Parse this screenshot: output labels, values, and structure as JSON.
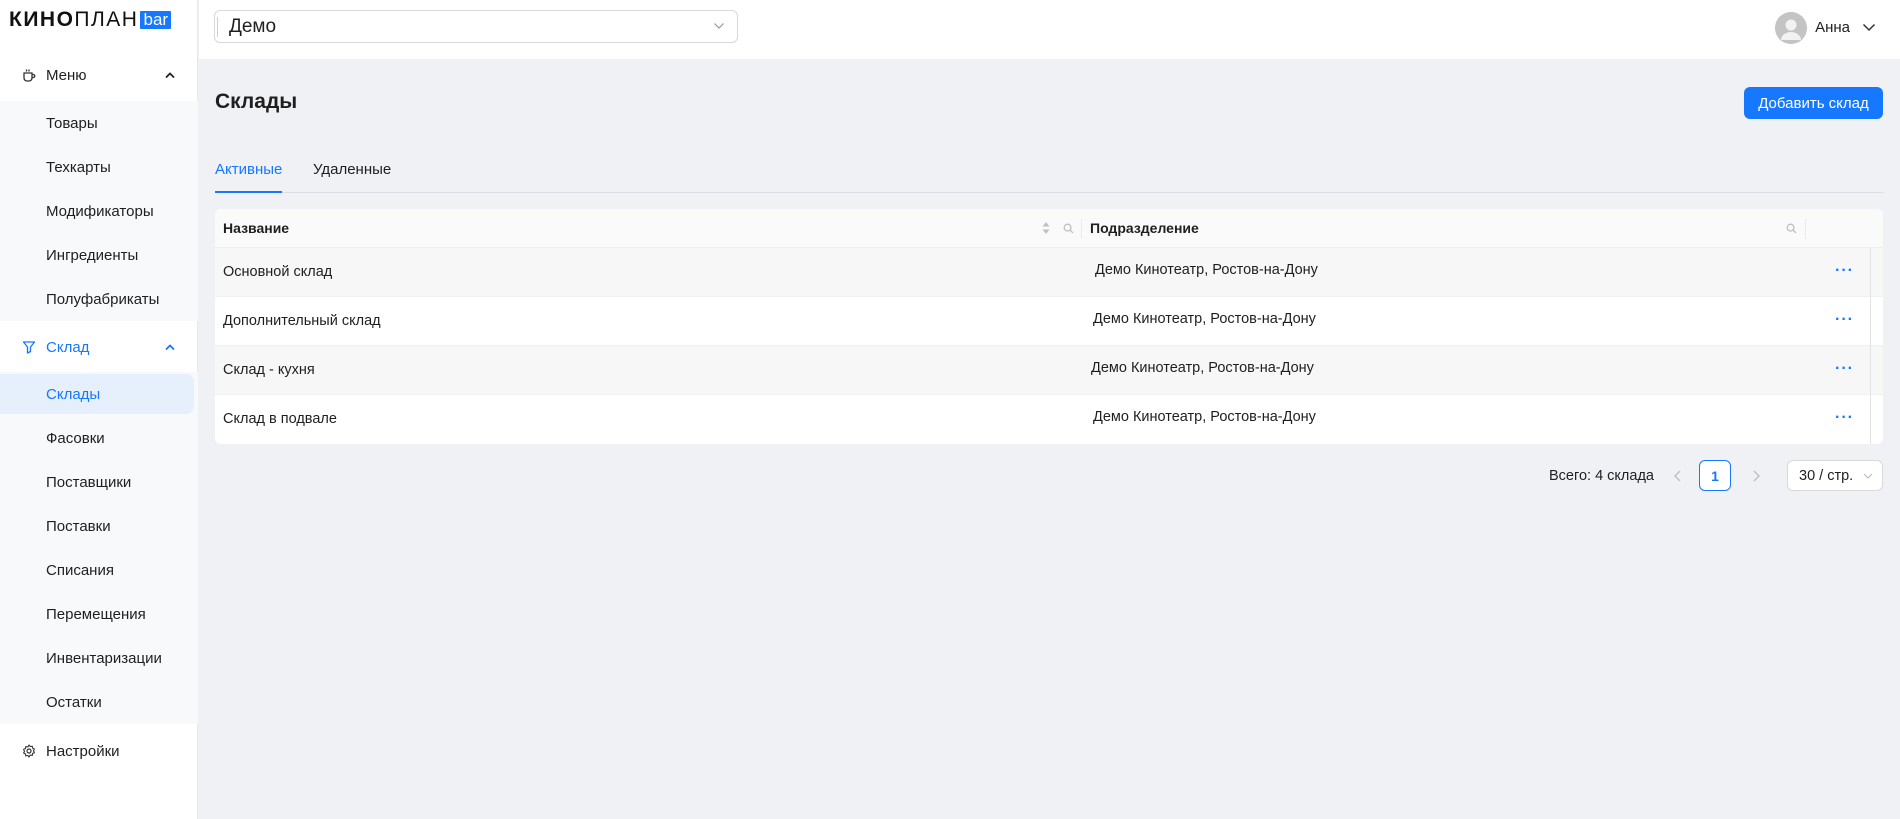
{
  "brand": {
    "part1": "КИНО",
    "part2": "ПЛАН",
    "part3": "bar"
  },
  "sidebar": {
    "menu": {
      "label": "Меню",
      "items": [
        "Товары",
        "Техкарты",
        "Модификаторы",
        "Ингредиенты",
        "Полуфабрикаты"
      ]
    },
    "warehouse": {
      "label": "Склад",
      "items": [
        "Склады",
        "Фасовки",
        "Поставщики",
        "Поставки",
        "Списания",
        "Перемещения",
        "Инвентаризации",
        "Остатки"
      ]
    },
    "settings": {
      "label": "Настройки"
    }
  },
  "topbar": {
    "selector_value": "Демо",
    "user_name": "Анна"
  },
  "page": {
    "title": "Склады",
    "add_button": "Добавить склад"
  },
  "tabs": [
    "Активные",
    "Удаленные"
  ],
  "table": {
    "headers": {
      "name": "Название",
      "division": "Подразделение"
    },
    "rows": [
      {
        "name": "Основной склад",
        "division": "Демо Кинотеатр, Ростов-на-Дону"
      },
      {
        "name": "Дополнительный склад",
        "division": "Демо Кинотеатр, Ростов-на-Дону"
      },
      {
        "name": "Склад - кухня",
        "division": "Демо Кинотеатр, Ростов-на-Дону"
      },
      {
        "name": "Склад в подвале",
        "division": "Демо Кинотеатр, Ростов-на-Дону"
      }
    ],
    "more_label": "···"
  },
  "pagination": {
    "total": "Всего: 4 склада",
    "current_page": "1",
    "page_size": "30 / стр."
  },
  "colors": {
    "accent": "#1677ff",
    "sidebar_selected_bg": "#e6f0fd",
    "page_bg": "#f0f1f5"
  }
}
